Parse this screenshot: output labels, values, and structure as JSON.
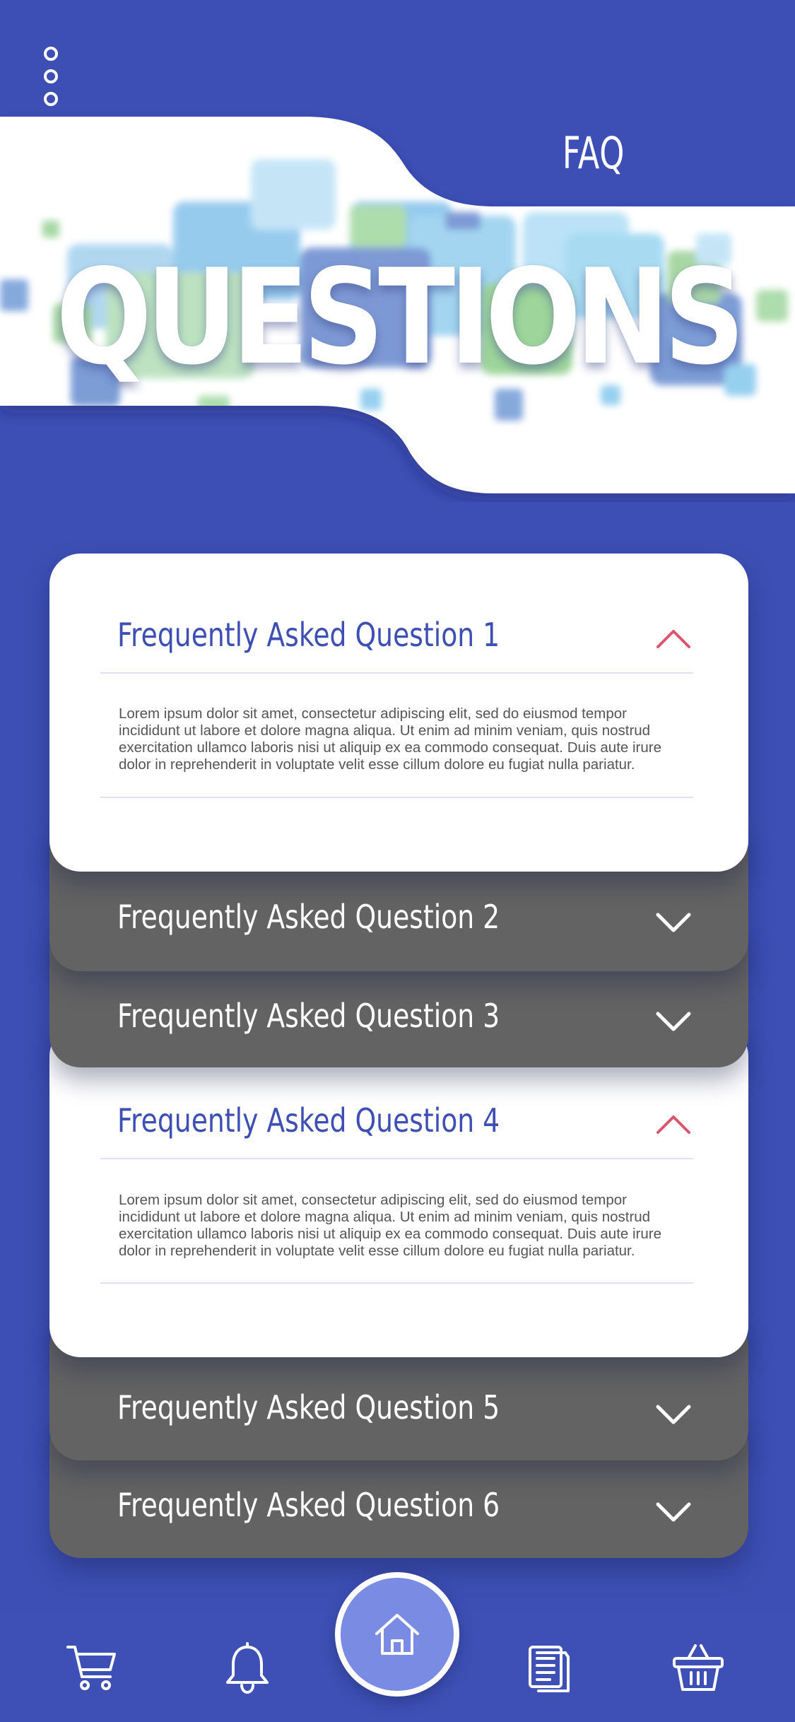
{
  "header": {
    "title": "FAQ",
    "hero_word": "QUESTIONS"
  },
  "faq": [
    {
      "question": "Frequently Asked Question 1",
      "answer": "Lorem ipsum dolor sit amet, consectetur adipiscing elit, sed do eiusmod tempor incididunt ut labore et dolore magna aliqua. Ut enim ad minim veniam, quis nostrud exercitation ullamco laboris nisi ut aliquip ex ea commodo consequat. Duis aute irure dolor in reprehenderit in voluptate velit esse cillum dolore eu fugiat nulla pariatur.",
      "expanded": true
    },
    {
      "question": "Frequently Asked Question 2",
      "expanded": false
    },
    {
      "question": "Frequently Asked Question 3",
      "expanded": false
    },
    {
      "question": "Frequently Asked Question 4",
      "answer": "Lorem ipsum dolor sit amet, consectetur adipiscing elit, sed do eiusmod tempor incididunt ut labore et dolore magna aliqua. Ut enim ad minim veniam, quis nostrud exercitation ullamco laboris nisi ut aliquip ex ea commodo consequat. Duis aute irure dolor in reprehenderit in voluptate velit esse cillum dolore eu fugiat nulla pariatur.",
      "expanded": true
    },
    {
      "question": "Frequently Asked Question 5",
      "expanded": false
    },
    {
      "question": "Frequently Asked Question 6",
      "expanded": false
    }
  ],
  "bottom_nav": {
    "items": [
      "cart-icon",
      "bell-icon",
      "home-icon",
      "document-icon",
      "basket-icon"
    ],
    "active": "home-icon"
  },
  "colors": {
    "background": "#3d4fb5",
    "accent_text": "#3d4fb5",
    "closed_card": "#636363",
    "chevron_open": "#d9566b",
    "home_button": "#7a8be4"
  }
}
